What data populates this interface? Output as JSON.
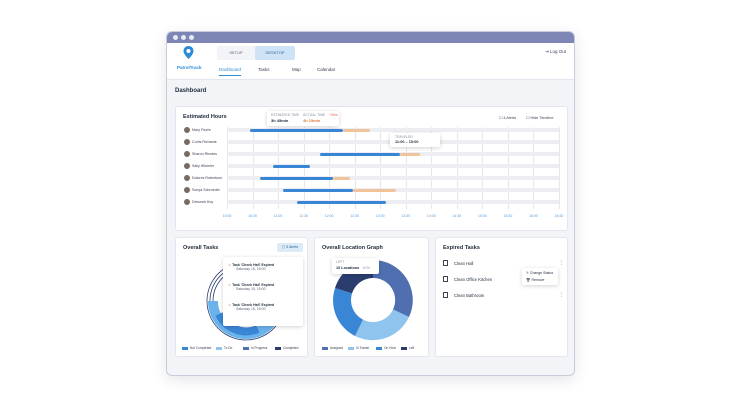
{
  "app": {
    "logo_text": "PatrolTrack",
    "toggle_setup": "SETUP",
    "toggle_desktop": "DESKTOP",
    "logout": "Log Out",
    "tabs": [
      {
        "label": "Dashboard",
        "active": true
      },
      {
        "label": "Tasks",
        "active": false
      },
      {
        "label": "Map",
        "active": false
      },
      {
        "label": "Calendar",
        "active": false
      }
    ],
    "page_title": "Dashboard"
  },
  "colors": {
    "accent": "#2b8cd6",
    "scheduled": "#3a86d6",
    "actual": "#f0c39a",
    "chrome": "#7d86b4"
  },
  "estimated_hours": {
    "title": "Estimated Hours",
    "alerts_label": "4 Alerts",
    "hide_timeline_label": "Hide Timeline",
    "times": [
      "10:00",
      "10:30",
      "11:00",
      "11:30",
      "12:00",
      "12:30",
      "13:00",
      "13:30",
      "14:00",
      "14:30",
      "15:00",
      "15:30",
      "16:00",
      "16:30"
    ],
    "rows": [
      {
        "name": "Mary Fischr",
        "scheduled": [
          0.07,
          0.35
        ],
        "actual": [
          0.35,
          0.43
        ]
      },
      {
        "name": "Curtis Richards",
        "scheduled": null,
        "actual": null
      },
      {
        "name": "Sharon Rhodes",
        "scheduled": [
          0.28,
          0.52
        ],
        "actual": [
          0.52,
          0.58
        ]
      },
      {
        "name": "Sally Wheeler",
        "scheduled": [
          0.14,
          0.25
        ],
        "actual": null
      },
      {
        "name": "Dolores Robertson",
        "scheduled": [
          0.1,
          0.32
        ],
        "actual": [
          0.32,
          0.37
        ]
      },
      {
        "name": "Sonya Schroeder",
        "scheduled": [
          0.17,
          0.38
        ],
        "actual": [
          0.38,
          0.51
        ]
      },
      {
        "name": "Deborah Hoy",
        "scheduled": [
          0.21,
          0.48
        ],
        "actual": null
      }
    ],
    "tooltip_top": {
      "estimated_label": "ESTIMATED TIME",
      "estimated_value": "3h 45min",
      "actual_label": "ACTUAL TIME",
      "actual_value": "4h 15min",
      "delta": "+30m"
    },
    "tooltip_mid": {
      "label": "TRAVELER",
      "value": "11:00 – 15:00"
    }
  },
  "overall_tasks": {
    "title": "Overall Tasks",
    "alerts_label": "5 Alerts",
    "alerts": [
      {
        "title": "Task 'Check Hall' Expired",
        "date": "Saturday 15, 15:00"
      },
      {
        "title": "Task 'Check Hall' Expired",
        "date": "Saturday 15, 15:00"
      },
      {
        "title": "Task 'Check Hall' Expired",
        "date": "Saturday 15, 15:00"
      }
    ],
    "legend": [
      "Not Completed",
      "To Do",
      "In Progress",
      "Completed"
    ]
  },
  "location_graph": {
    "title": "Overall Location Graph",
    "tooltip_label": "LEFT",
    "tooltip_value": "10 Locations",
    "tooltip_pct": "10%",
    "legend": [
      "Assigned",
      "In Transit",
      "On Hold",
      "Left"
    ]
  },
  "expired_tasks": {
    "title": "Expired Tasks",
    "items": [
      "Clean Hall",
      "Clean Office Kitchen",
      "Clean Bathroom"
    ],
    "menu": [
      "Change Status",
      "Remove"
    ]
  }
}
